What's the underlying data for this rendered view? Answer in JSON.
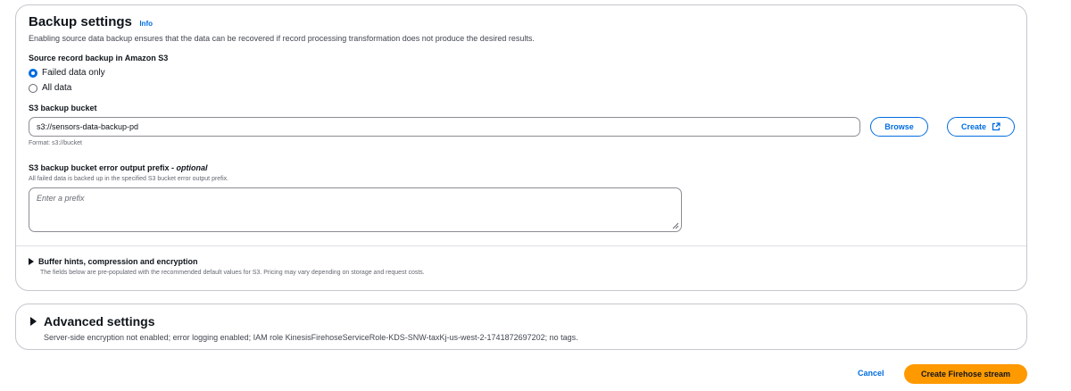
{
  "backup": {
    "title": "Backup settings",
    "info": "Info",
    "description": "Enabling source data backup ensures that the data can be recovered if record processing transformation does not produce the desired results.",
    "source_label": "Source record backup in Amazon S3",
    "options": [
      {
        "label": "Failed data only",
        "selected": true
      },
      {
        "label": "All data",
        "selected": false
      }
    ],
    "bucket_label": "S3 backup bucket",
    "bucket_value": "s3://sensors-data-backup-pd",
    "browse_label": "Browse",
    "create_label": "Create",
    "bucket_format": "Format: s3://bucket",
    "prefix_label": "S3 backup bucket error output prefix - ",
    "prefix_optional": "optional",
    "prefix_hint": "All failed data is backed up in the specified S3 bucket error output prefix.",
    "prefix_placeholder": "Enter a prefix",
    "buffer_title": "Buffer hints, compression and encryption",
    "buffer_desc": "The fields below are pre-populated with the recommended default values for S3. Pricing may vary depending on storage and request costs."
  },
  "advanced": {
    "title": "Advanced settings",
    "summary": "Server-side encryption not enabled; error logging enabled; IAM role KinesisFirehoseServiceRole-KDS-SNW-taxKj-us-west-2-1741872697202; no tags."
  },
  "footer": {
    "cancel_label": "Cancel",
    "submit_label": "Create Firehose stream"
  },
  "colors": {
    "accent": "#006ce0",
    "primary_button": "#ff9900",
    "border": "#c6c6cd"
  },
  "icons": [
    "external-link-icon",
    "caret-right-icon",
    "resize-grip-icon"
  ]
}
